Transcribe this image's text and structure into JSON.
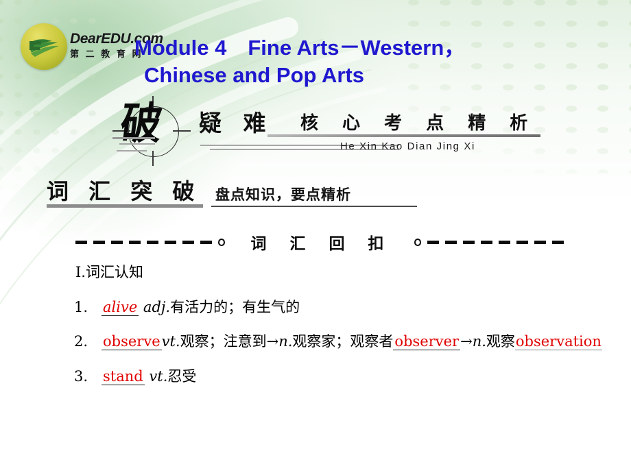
{
  "slide": {
    "logo": {
      "brand": "DearEDU.com",
      "sub": "第 二 教 育 网",
      "mark_name": "dearedu-logo-mark"
    },
    "title": {
      "line1": "Module 4　Fine Arts－Western，",
      "line2": "Chinese and Pop Arts",
      "color": "#1f18cf"
    },
    "banner": {
      "calligraphy_char": "破",
      "keyword": "疑 难",
      "headline": "核 心 考 点 精 析",
      "pinyin": "He Xin Kao Dian Jing Xi"
    },
    "section_header": {
      "title": "词 汇 突 破",
      "subtitle": "盘点知识，要点精析"
    },
    "divider": {
      "label": "词 汇 回 扣",
      "dash_count": 8
    },
    "content": {
      "heading": "Ⅰ.词汇认知",
      "items": [
        {
          "number": "1.",
          "answer": "alive",
          "rest": " adj.有活力的；有生气的"
        },
        {
          "number": "2.",
          "answer": "observe",
          "rest": " vt.观察；注意到→n.观察家；观察者",
          "answer2": "observer",
          "rest2": "→n.观察",
          "wrap_prefix": "察",
          "answer3": "observation"
        },
        {
          "number": "3.",
          "answer": "stand",
          "rest": " vt.忍受"
        }
      ]
    }
  }
}
